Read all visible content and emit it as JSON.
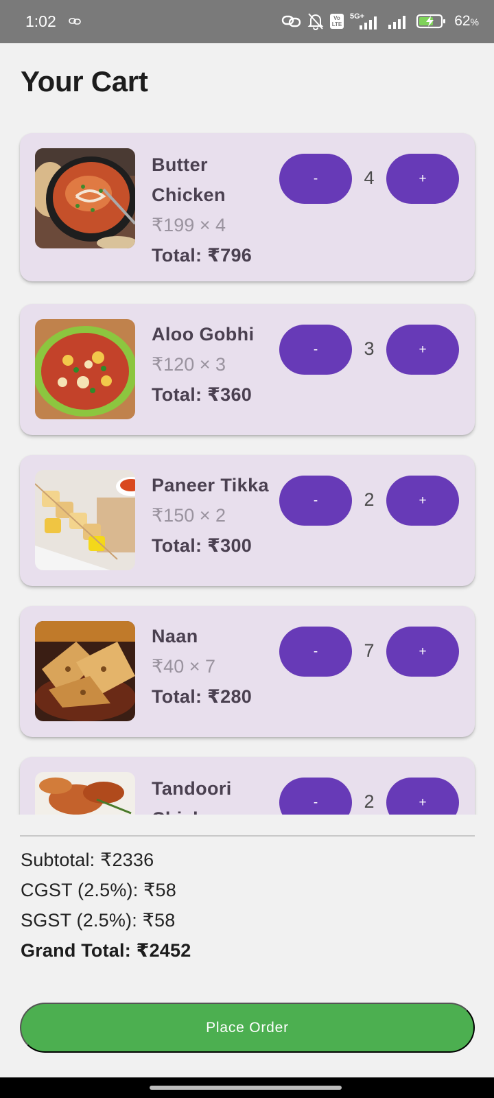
{
  "status_bar": {
    "time": "1:02",
    "network": "5G+",
    "volte_line1": "Vo",
    "volte_line2": "LTE",
    "battery_percent": "62",
    "battery_unit": "%"
  },
  "page": {
    "title": "Your Cart"
  },
  "cart": {
    "items": [
      {
        "name_line1": "Butter",
        "name_line2": "Chicken",
        "unit_text": "₹199 × 4",
        "total_text": "Total: ₹796",
        "quantity": "4",
        "minus_label": "-",
        "plus_label": "+",
        "image_icon": "butter-chicken-image"
      },
      {
        "name_line1": "Aloo Gobhi",
        "unit_text": "₹120 × 3",
        "total_text": "Total: ₹360",
        "quantity": "3",
        "minus_label": "-",
        "plus_label": "+",
        "image_icon": "aloo-gobhi-image"
      },
      {
        "name_line1": "Paneer Tikka",
        "unit_text": "₹150 × 2",
        "total_text": "Total: ₹300",
        "quantity": "2",
        "minus_label": "-",
        "plus_label": "+",
        "image_icon": "paneer-tikka-image"
      },
      {
        "name_line1": "Naan",
        "unit_text": "₹40 × 7",
        "total_text": "Total: ₹280",
        "quantity": "7",
        "minus_label": "-",
        "plus_label": "+",
        "image_icon": "naan-image"
      },
      {
        "name_line1": "Tandoori",
        "name_line2": "Chicken",
        "quantity": "2",
        "minus_label": "-",
        "plus_label": "+",
        "image_icon": "tandoori-chicken-image"
      }
    ]
  },
  "summary": {
    "subtotal": "Subtotal: ₹2336",
    "cgst": "CGST (2.5%): ₹58",
    "sgst": "SGST (2.5%): ₹58",
    "grand_total": "Grand Total: ₹2452"
  },
  "actions": {
    "place_order_label": "Place Order"
  },
  "colors": {
    "accent": "#673ab7",
    "card_background": "#e8dfed",
    "place_order": "#4caf50",
    "status_bar": "#7a7a7a"
  }
}
